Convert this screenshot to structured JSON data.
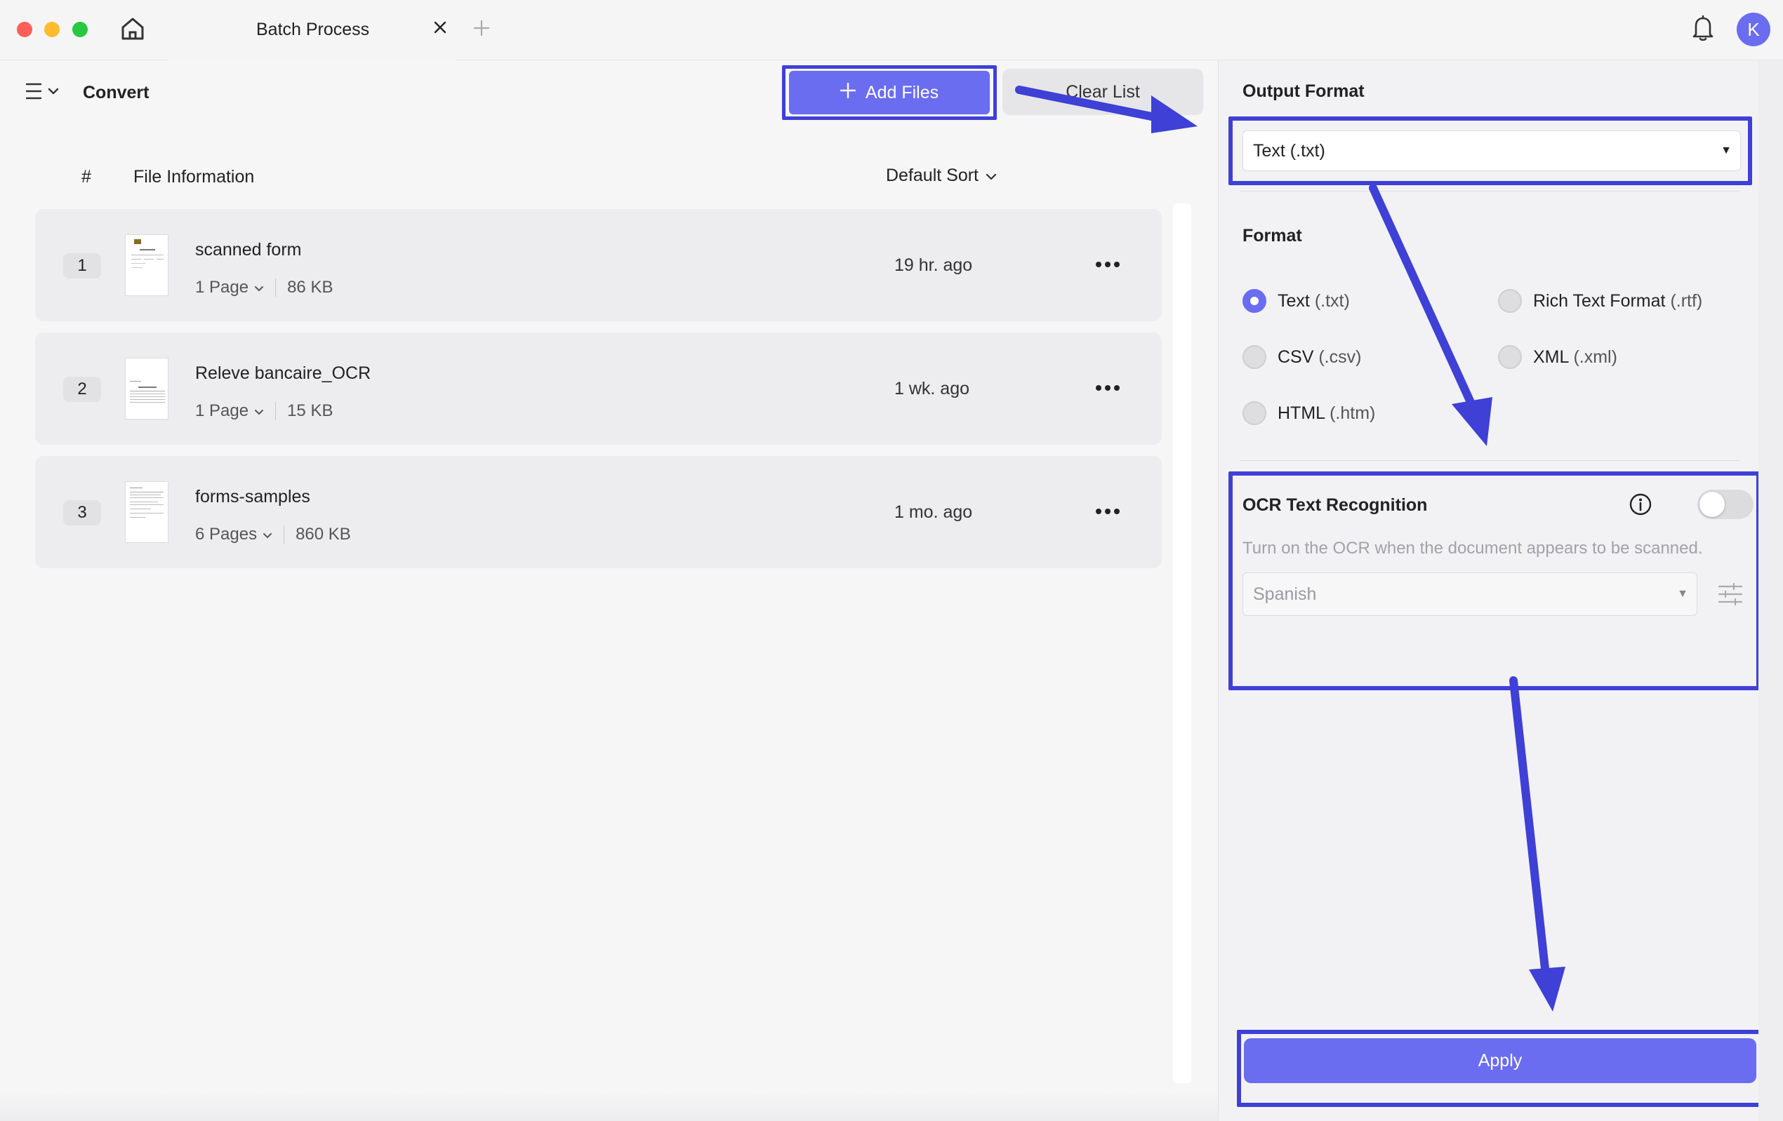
{
  "window": {
    "tab_title": "Batch Process",
    "avatar_initial": "K"
  },
  "toolbar": {
    "section_title": "Convert",
    "add_files_label": "Add Files",
    "clear_list_label": "Clear List"
  },
  "file_list": {
    "columns": {
      "index": "#",
      "info": "File Information",
      "sort": "Default Sort"
    },
    "rows": [
      {
        "index": "1",
        "name": "scanned form",
        "pages": "1 Page",
        "size": "86 KB",
        "time": "19 hr. ago"
      },
      {
        "index": "2",
        "name": "Releve bancaire_OCR",
        "pages": "1 Page",
        "size": "15 KB",
        "time": "1 wk. ago"
      },
      {
        "index": "3",
        "name": "forms-samples",
        "pages": "6 Pages",
        "size": "860 KB",
        "time": "1 mo. ago"
      }
    ]
  },
  "panel": {
    "output_format_label": "Output Format",
    "output_format_value": "Text (.txt)",
    "format_label": "Format",
    "formats": [
      {
        "name": "Text",
        "ext": "(.txt)",
        "selected": true
      },
      {
        "name": "Rich Text Format",
        "ext": "(.rtf)",
        "selected": false
      },
      {
        "name": "CSV",
        "ext": "(.csv)",
        "selected": false
      },
      {
        "name": "XML",
        "ext": "(.xml)",
        "selected": false
      },
      {
        "name": "HTML",
        "ext": "(.htm)",
        "selected": false
      }
    ],
    "ocr": {
      "title": "OCR Text Recognition",
      "enabled": false,
      "hint": "Turn on the OCR when the document appears to be scanned.",
      "language": "Spanish"
    },
    "apply_label": "Apply"
  },
  "colors": {
    "accent": "#6a6df0",
    "highlight": "#3f40d6"
  }
}
